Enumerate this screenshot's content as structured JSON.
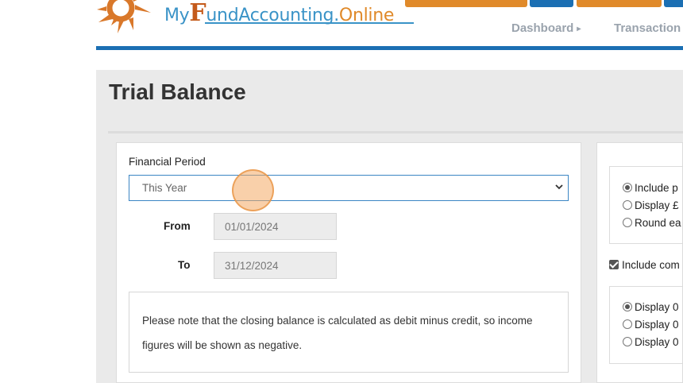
{
  "brand": {
    "my": "My",
    "f": "F",
    "fund_accounting": "undAccounting",
    "dot": ".",
    "online": "Online"
  },
  "nav": {
    "dashboard": "Dashboard",
    "transactions": "Transaction"
  },
  "page": {
    "title": "Trial Balance"
  },
  "filters": {
    "financial_period_label": "Financial Period",
    "financial_period_value": "This Year",
    "from_label": "From",
    "from_value": "01/01/2024",
    "to_label": "To",
    "to_value": "31/12/2024",
    "note_line1": "Please note that the closing balance is calculated as debit minus credit, so income",
    "note_line2": "figures will be shown as negative."
  },
  "options": {
    "group1": [
      "Include p",
      "Display £",
      "Round ea"
    ],
    "include_checkbox": "Include com",
    "group2": [
      "Display 0",
      "Display 0",
      "Display 0"
    ]
  },
  "colors": {
    "brand_blue": "#1b6fb3",
    "top_button_orange": "#e08a2a",
    "top_button_blue": "#1b6fb3"
  }
}
